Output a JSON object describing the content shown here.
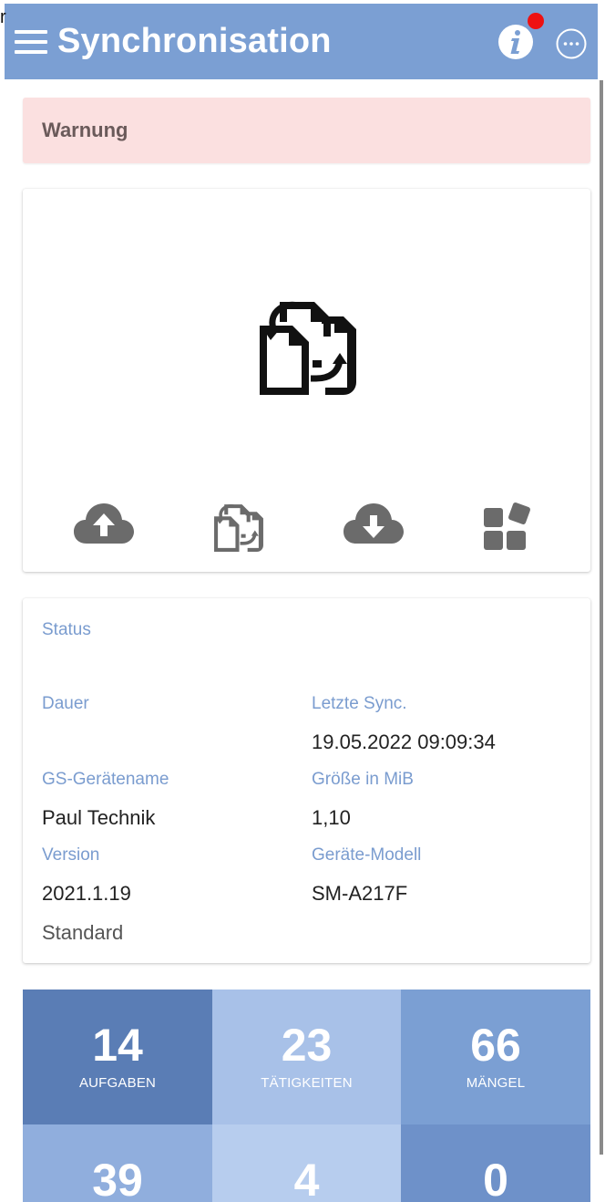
{
  "overlay_char": "r",
  "header": {
    "title": "Synchronisation",
    "info_icon": "info-icon",
    "more_icon": "more-horizontal-icon",
    "menu_icon": "hamburger-menu-icon",
    "notification_dot": true,
    "colors": {
      "bar": "#7b9fd3",
      "dot": "#ee1111"
    }
  },
  "warning": {
    "text": "Warnung",
    "color": "#fbe0e0"
  },
  "sync": {
    "main_icon": "file-sync-icon",
    "actions": [
      {
        "name": "upload-cloud-icon"
      },
      {
        "name": "file-sync-icon"
      },
      {
        "name": "download-cloud-icon"
      },
      {
        "name": "apps-icon"
      }
    ]
  },
  "status": {
    "title": "Status",
    "dauer_label": "Dauer",
    "letzte_sync_label": "Letzte Sync.",
    "letzte_sync_value": "19.05.2022 09:09:34",
    "geraetename_label": "GS-Gerätename",
    "geraetename_value": "Paul Technik",
    "groesse_label": "Größe in MiB",
    "groesse_value": "1,10",
    "version_label": "Version",
    "version_value": "2021.1.19",
    "modell_label": "Geräte-Modell",
    "modell_value": "SM-A217F",
    "standard": "Standard"
  },
  "tiles": [
    {
      "value": "14",
      "caption": "AUFGABEN",
      "color": "#5a7db5"
    },
    {
      "value": "23",
      "caption": "TÄTIGKEITEN",
      "color": "#a8c1e8"
    },
    {
      "value": "66",
      "caption": "MÄNGEL",
      "color": "#7b9fd3"
    },
    {
      "value": "39",
      "caption": "",
      "color": "#90aedd"
    },
    {
      "value": "4",
      "caption": "",
      "color": "#b7cdee"
    },
    {
      "value": "0",
      "caption": "",
      "color": "#6e91c9"
    }
  ]
}
